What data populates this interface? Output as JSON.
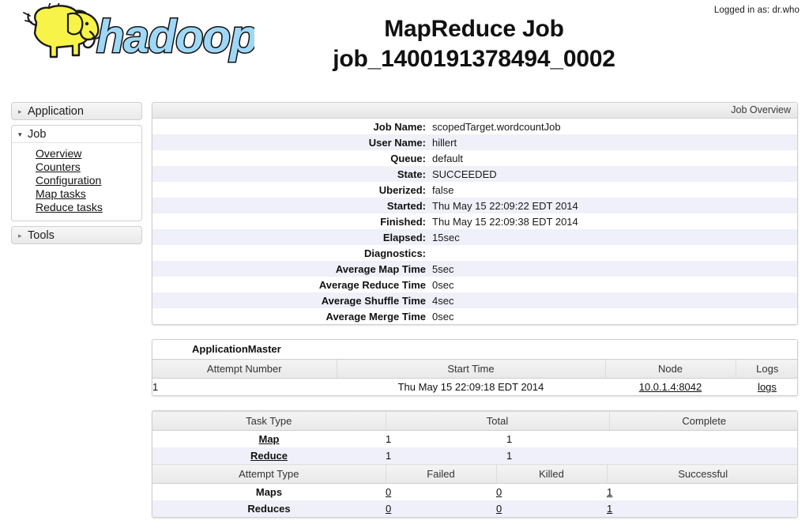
{
  "header": {
    "logged_in": "Logged in as: dr.who",
    "logo_alt": "hadoop-logo",
    "title_line1": "MapReduce Job",
    "title_line2": "job_1400191378494_0002"
  },
  "sidebar": {
    "blocks": [
      {
        "label": "Application",
        "open": false,
        "icon": "chevron-right-icon",
        "items": []
      },
      {
        "label": "Job",
        "open": true,
        "icon": "chevron-down-icon",
        "items": [
          "Overview",
          "Counters",
          "Configuration",
          "Map tasks",
          "Reduce tasks"
        ]
      },
      {
        "label": "Tools",
        "open": false,
        "icon": "chevron-right-icon",
        "items": []
      }
    ]
  },
  "job_overview": {
    "panel_title": "Job Overview",
    "rows": [
      {
        "label": "Job Name:",
        "value": "scopedTarget.wordcountJob"
      },
      {
        "label": "User Name:",
        "value": "hillert"
      },
      {
        "label": "Queue:",
        "value": "default"
      },
      {
        "label": "State:",
        "value": "SUCCEEDED"
      },
      {
        "label": "Uberized:",
        "value": "false"
      },
      {
        "label": "Started:",
        "value": "Thu May 15 22:09:22 EDT 2014"
      },
      {
        "label": "Finished:",
        "value": "Thu May 15 22:09:38 EDT 2014"
      },
      {
        "label": "Elapsed:",
        "value": "15sec"
      },
      {
        "label": "Diagnostics:",
        "value": ""
      },
      {
        "label": "Average Map Time",
        "value": "5sec"
      },
      {
        "label": "Average Reduce Time",
        "value": "0sec"
      },
      {
        "label": "Average Shuffle Time",
        "value": "4sec"
      },
      {
        "label": "Average Merge Time",
        "value": "0sec"
      }
    ]
  },
  "application_master": {
    "title": "ApplicationMaster",
    "columns": [
      "Attempt Number",
      "Start Time",
      "Node",
      "Logs"
    ],
    "rows": [
      {
        "attempt_number": "1",
        "start_time": "Thu May 15 22:09:18 EDT 2014",
        "node": "10.0.1.4:8042",
        "logs": "logs"
      }
    ]
  },
  "task_summary": {
    "columns": [
      "Task Type",
      "Total",
      "Complete"
    ],
    "rows": [
      {
        "task_type": "Map",
        "total": "1",
        "complete": "1"
      },
      {
        "task_type": "Reduce",
        "total": "1",
        "complete": "1"
      }
    ]
  },
  "attempt_summary": {
    "columns": [
      "Attempt Type",
      "Failed",
      "Killed",
      "Successful"
    ],
    "rows": [
      {
        "attempt_type": "Maps",
        "failed": "0",
        "killed": "0",
        "successful": "1"
      },
      {
        "attempt_type": "Reduces",
        "failed": "0",
        "killed": "0",
        "successful": "1"
      }
    ]
  },
  "colors": {
    "row_alt": "#eff0f9",
    "panel_border": "#cfcfcf",
    "header_gradient_top": "#f4f4f4",
    "header_gradient_bottom": "#e6e6e6",
    "logo_elephant": "#f7f348",
    "logo_text": "#9fd7f7",
    "text": "#111111"
  }
}
